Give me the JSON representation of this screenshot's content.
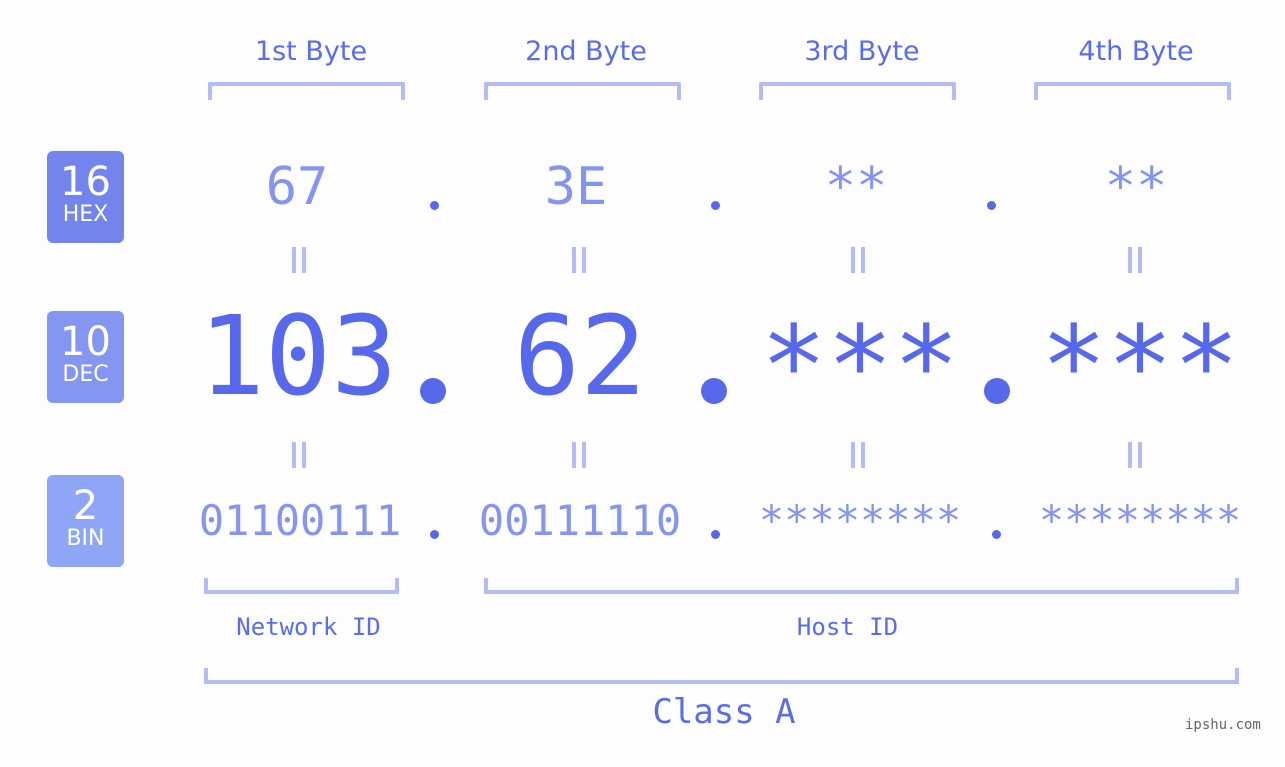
{
  "headers": [
    "1st Byte",
    "2nd Byte",
    "3rd Byte",
    "4th Byte"
  ],
  "badges": [
    {
      "num": "16",
      "label": "HEX",
      "color": "#7385ec"
    },
    {
      "num": "10",
      "label": "DEC",
      "color": "#8596f0"
    },
    {
      "num": "2",
      "label": "BIN",
      "color": "#8fa5f6"
    }
  ],
  "hex": [
    "67",
    "3E",
    "**",
    "**"
  ],
  "dec": [
    "103",
    "62",
    "***",
    "***"
  ],
  "bin": [
    "01100111",
    "00111110",
    "********",
    "********"
  ],
  "network_label": "Network ID",
  "host_label": "Host ID",
  "class_label": "Class A",
  "watermark": "ipshu.com",
  "colors": {
    "accent": "#5769ea",
    "bracket": "#b3bcf7",
    "light": "#8594ef"
  }
}
